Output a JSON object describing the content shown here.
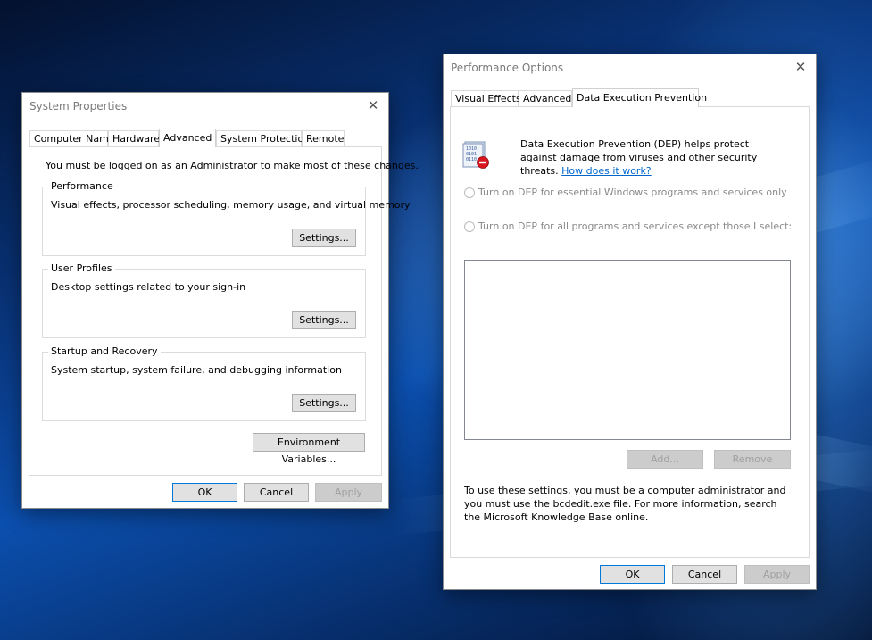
{
  "system_properties": {
    "title": "System Properties",
    "close_glyph": "✕",
    "tabs": [
      {
        "label": "Computer Name"
      },
      {
        "label": "Hardware"
      },
      {
        "label": "Advanced"
      },
      {
        "label": "System Protection"
      },
      {
        "label": "Remote"
      }
    ],
    "selected_tab": "Advanced",
    "admin_note": "You must be logged on as an Administrator to make most of these changes.",
    "groups": {
      "performance": {
        "title": "Performance",
        "description": "Visual effects, processor scheduling, memory usage, and virtual memory",
        "button": "Settings..."
      },
      "user_profiles": {
        "title": "User Profiles",
        "description": "Desktop settings related to your sign-in",
        "button": "Settings..."
      },
      "startup_recovery": {
        "title": "Startup and Recovery",
        "description": "System startup, system failure, and debugging information",
        "button": "Settings..."
      }
    },
    "env_button": "Environment Variables...",
    "buttons": {
      "ok": "OK",
      "cancel": "Cancel",
      "apply": "Apply"
    }
  },
  "performance_options": {
    "title": "Performance Options",
    "close_glyph": "✕",
    "tabs": [
      {
        "label": "Visual Effects"
      },
      {
        "label": "Advanced"
      },
      {
        "label": "Data Execution Prevention"
      }
    ],
    "selected_tab": "Data Execution Prevention",
    "dep_icon": "dep-shield-icon",
    "dep_description": "Data Execution Prevention (DEP) helps protect against damage from viruses and other security threats.",
    "dep_link": "How does it work?",
    "radio_essential": "Turn on DEP for essential Windows programs and services only",
    "radio_all": "Turn on DEP for all programs and services except those I select:",
    "list_buttons": {
      "add": "Add...",
      "remove": "Remove"
    },
    "admin_note": "To use these settings, you must be a computer administrator and you must use the bcdedit.exe file. For more information, search the Microsoft Knowledge Base online.",
    "buttons": {
      "ok": "OK",
      "cancel": "Cancel",
      "apply": "Apply"
    }
  }
}
